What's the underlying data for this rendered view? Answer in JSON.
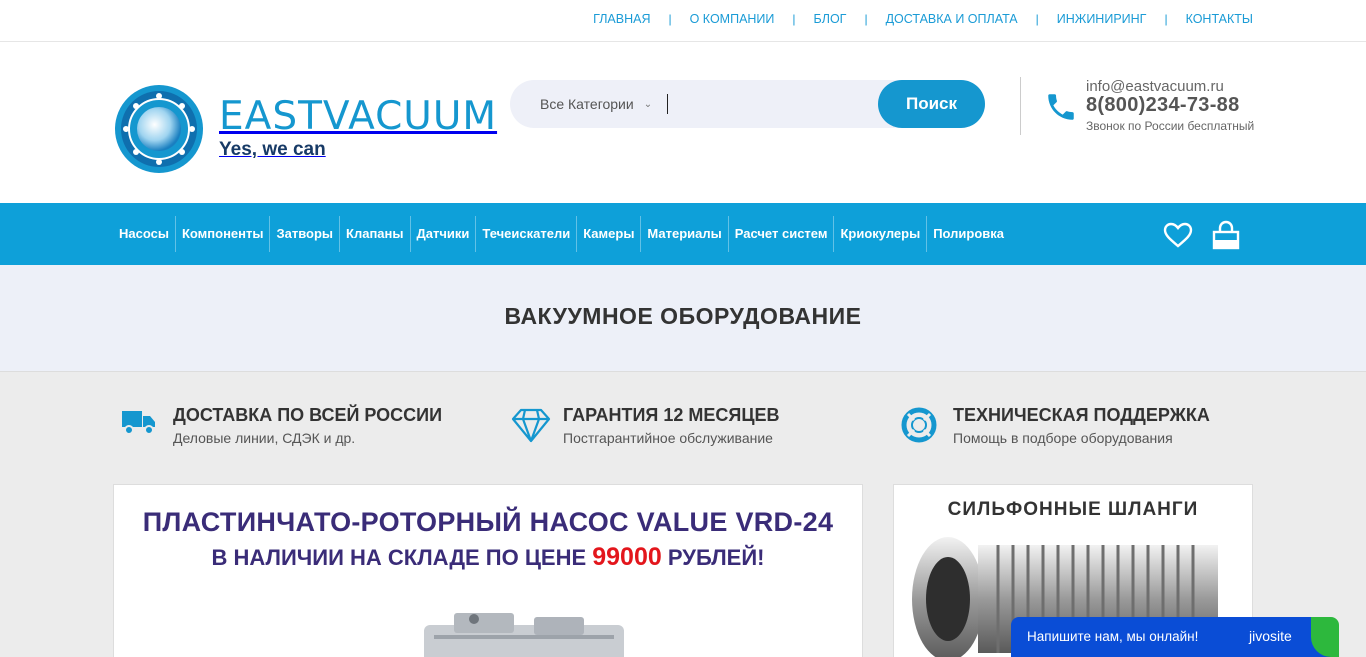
{
  "topnav": {
    "items": [
      "ГЛАВНАЯ",
      "О КОМПАНИИ",
      "БЛОГ",
      "ДОСТАВКА И ОПЛАТА",
      "ИНЖИНИРИНГ",
      "КОНТАКТЫ"
    ],
    "separator": "|"
  },
  "logo": {
    "name": "EASTVACUUM",
    "tagline": "Yes, we can"
  },
  "search": {
    "category": "Все Категории",
    "placeholder": "",
    "button": "Поиск"
  },
  "contact": {
    "email": "info@eastvacuum.ru",
    "phone": "8(800)234-73-88",
    "note": "Звонок по России бесплатный"
  },
  "categories": [
    "Насосы",
    "Компоненты",
    "Затворы",
    "Клапаны",
    "Датчики",
    "Течеискатели",
    "Камеры",
    "Материалы",
    "Расчет систем",
    "Криокулеры",
    "Полировка"
  ],
  "hero": {
    "title": "ВАКУУМНОЕ ОБОРУДОВАНИЕ"
  },
  "features": [
    {
      "title": "ДОСТАВКА ПО ВСЕЙ РОССИИ",
      "subtitle": "Деловые линии, СДЭК и др.",
      "icon": "truck-icon"
    },
    {
      "title": "ГАРАНТИЯ 12 МЕСЯЦЕВ",
      "subtitle": "Постгарантийное обслуживание",
      "icon": "diamond-icon"
    },
    {
      "title": "ТЕХНИЧЕСКАЯ ПОДДЕРЖКА",
      "subtitle": "Помощь в подборе оборудования",
      "icon": "lifebuoy-icon"
    }
  ],
  "banner_main": {
    "line1": "ПЛАСТИНЧАТО-РОТОРНЫЙ НАСОС VALUE VRD-24",
    "line2_pre": "В НАЛИЧИИ НА СКЛАДЕ ПО ЦЕНЕ ",
    "price": "99000",
    "line2_post": " РУБЛЕЙ!"
  },
  "banner_side": {
    "title": "СИЛЬФОННЫЕ ШЛАНГИ"
  },
  "chat": {
    "text": "Напишите нам, мы онлайн!",
    "brand": "jivosite"
  },
  "colors": {
    "accent": "#0ea0d9",
    "brand_blue": "#1597cf",
    "navy": "#173a66",
    "price_red": "#e3161c",
    "chat_blue": "#0a4dd6"
  }
}
